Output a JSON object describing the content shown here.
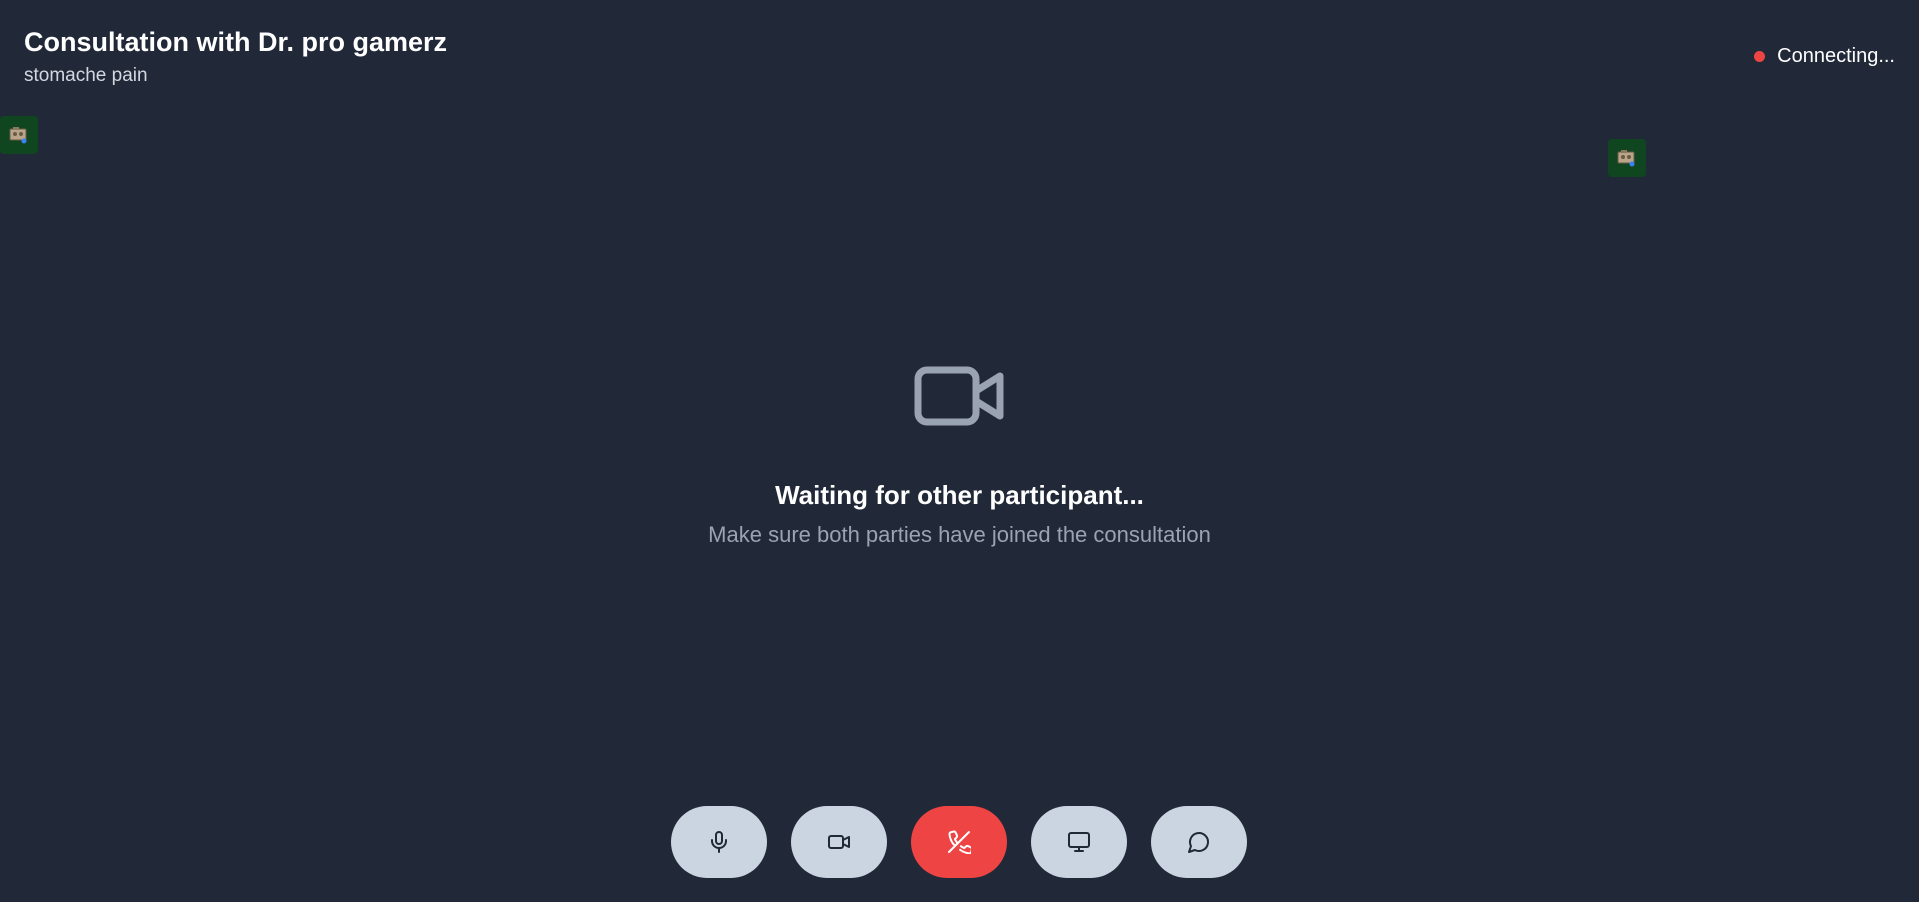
{
  "header": {
    "title": "Consultation with Dr. pro gamerz",
    "subtitle": "stomache pain"
  },
  "status": {
    "text": "Connecting...",
    "color": "#ef4444"
  },
  "thumbnails": [
    {
      "name": "local-video-thumbnail",
      "icon": "broken-image-icon"
    },
    {
      "name": "remote-video-thumbnail",
      "icon": "broken-image-icon"
    }
  ],
  "waiting": {
    "icon": "video-camera-icon",
    "title": "Waiting for other participant...",
    "subtitle": "Make sure both parties have joined the consultation"
  },
  "controls": [
    {
      "name": "microphone-button",
      "icon": "microphone-icon"
    },
    {
      "name": "camera-button",
      "icon": "video-camera-icon"
    },
    {
      "name": "end-call-button",
      "icon": "phone-off-icon",
      "color": "#ef4444"
    },
    {
      "name": "screen-share-button",
      "icon": "monitor-icon"
    },
    {
      "name": "chat-button",
      "icon": "chat-bubble-icon"
    }
  ],
  "colors": {
    "background": "#212938",
    "control": "#cbd5e1",
    "end_call": "#ef4444",
    "thumbnail": "#0f4620"
  }
}
